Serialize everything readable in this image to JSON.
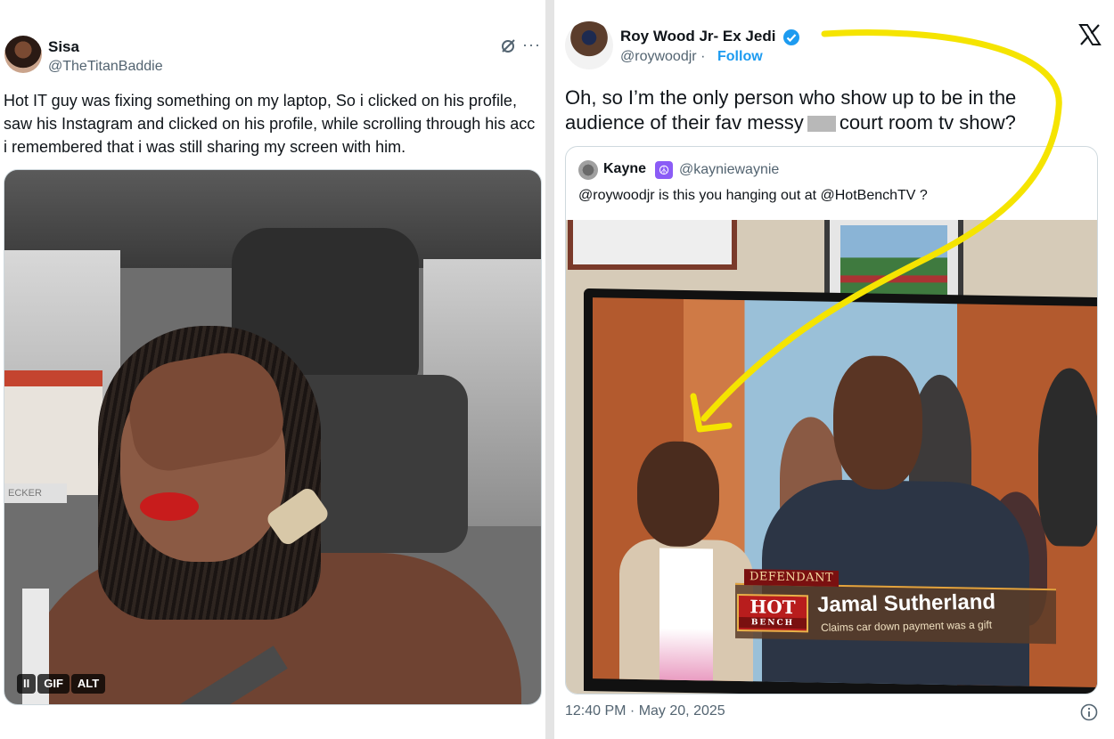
{
  "left_tweet": {
    "author_name": "Sisa",
    "author_handle": "@TheTitanBaddie",
    "more_label": "···",
    "text": "Hot IT guy was fixing something on my laptop, So i clicked on his profile, saw his Instagram and clicked on his profile, while scrolling through his acc i remembered that i was still sharing my screen with him.",
    "media_box_label": "ECKER",
    "controls": {
      "pause_label": "II",
      "gif_label": "GIF",
      "alt_label": "ALT"
    }
  },
  "right_tweet": {
    "author_name": "Roy Wood Jr- Ex Jedi",
    "author_handle": "@roywoodjr",
    "separator": "·",
    "follow_label": "Follow",
    "text_before_censor": "Oh, so I’m the only person who show up to be in the audience of their fav messy",
    "text_after_censor": "court room tv show?",
    "timestamp": "12:40 PM · May 20, 2025",
    "quote": {
      "author_name": "Kayne",
      "author_handle": "@kayniewaynie",
      "text": "@roywoodjr is this you hanging out at @HotBenchTV ?",
      "tv_overlay": {
        "label": "DEFENDANT",
        "logo_top": "HOT",
        "logo_bottom": "BENCH",
        "name": "Jamal Sutherland",
        "caption": "Claims car down payment was a gift"
      }
    }
  },
  "colors": {
    "link_blue": "#1d9bf0",
    "secondary_text": "#536471",
    "annotation_yellow": "#f5e400",
    "divider": "#e4e4e4"
  },
  "icons": {
    "grok": "grok-icon",
    "more": "more-icon",
    "verified": "verified-badge-icon",
    "x_logo": "x-logo-icon",
    "peace": "peace-emoji-icon",
    "info": "info-icon"
  }
}
